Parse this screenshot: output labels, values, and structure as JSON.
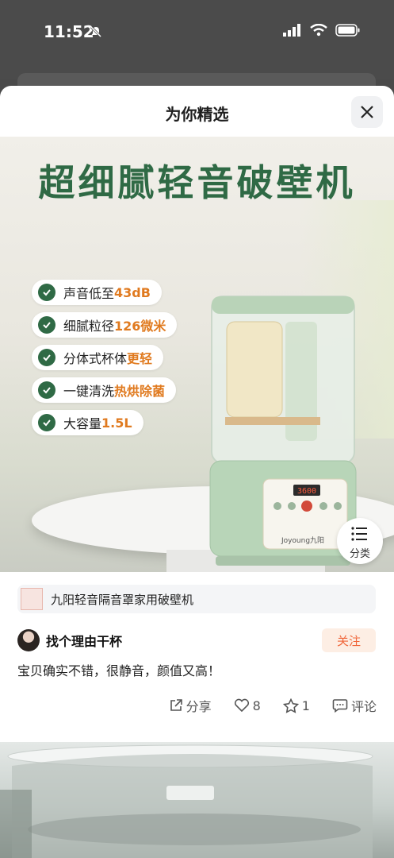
{
  "status": {
    "time": "11:52"
  },
  "header": {
    "title": "为你精选"
  },
  "hero": {
    "title": "超细腻轻音破壁机",
    "features": [
      {
        "text": "声音低至",
        "highlight": "43dB"
      },
      {
        "text": "细腻粒径",
        "highlight": "126微米"
      },
      {
        "text": "分体式杯体",
        "highlight": "更轻"
      },
      {
        "text": "一键清洗",
        "highlight": "热烘除菌"
      },
      {
        "text": "大容量",
        "highlight": "1.5L"
      }
    ],
    "display_value": "3600",
    "brand": "Joyoung九阳"
  },
  "filter": {
    "label": "分类"
  },
  "product": {
    "name": "九阳轻音隔音罩家用破壁机"
  },
  "author": {
    "name": "找个理由干杯",
    "follow_label": "关注"
  },
  "review": {
    "text": "宝贝确实不错，很静音，颜值又高！"
  },
  "actions": {
    "share": "分享",
    "likes": "8",
    "favorites": "1",
    "comment": "评论"
  },
  "colors": {
    "accent_green": "#2f6a45",
    "highlight_orange": "#e07a1f",
    "follow": "#f0663a"
  }
}
